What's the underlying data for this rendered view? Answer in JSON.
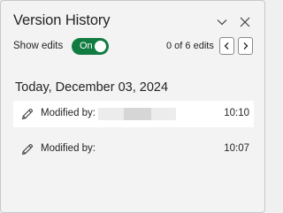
{
  "panel": {
    "title": "Version History",
    "collapse_icon": "chevron-down-icon",
    "close_icon": "close-icon"
  },
  "show_edits": {
    "label": "Show edits",
    "toggle_text": "On",
    "toggle_on": true,
    "accent_color": "#107c41"
  },
  "navigation": {
    "count_text": "0 of 6 edits",
    "prev_icon": "chevron-left-icon",
    "next_icon": "chevron-right-icon"
  },
  "date_group": {
    "heading": "Today, December 03, 2024"
  },
  "versions": [
    {
      "icon": "pencil-icon",
      "label": "Modified by:",
      "author": "",
      "time": "10:10",
      "selected": true
    },
    {
      "icon": "pencil-icon",
      "label": "Modified by:",
      "author": "",
      "time": "10:07",
      "selected": false
    }
  ]
}
